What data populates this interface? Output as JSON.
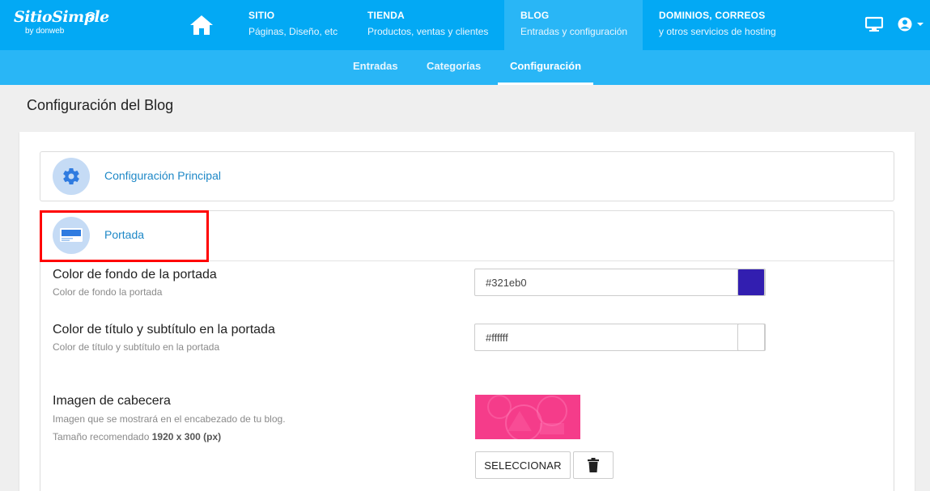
{
  "logo": {
    "brand": "SitioSimple",
    "sub": "by donweb"
  },
  "nav": [
    {
      "title": "SITIO",
      "subtitle": "Páginas, Diseño, etc"
    },
    {
      "title": "TIENDA",
      "subtitle": "Productos, ventas y clientes"
    },
    {
      "title": "BLOG",
      "subtitle": "Entradas y configuración"
    },
    {
      "title": "DOMINIOS, CORREOS",
      "subtitle": "y otros servicios de hosting"
    }
  ],
  "subnav": [
    "Entradas",
    "Categorías",
    "Configuración"
  ],
  "page_title": "Configuración del Blog",
  "panels": [
    {
      "label": "Configuración Principal",
      "icon": "gear-icon"
    },
    {
      "label": "Portada",
      "icon": "screen-icon"
    }
  ],
  "fields": {
    "bg_color": {
      "label": "Color de fondo de la portada",
      "help": "Color de fondo la portada",
      "value": "#321eb0",
      "swatch": "#321eb0"
    },
    "title_color": {
      "label": "Color de título y subtítulo en la portada",
      "help": "Color de título y subtítulo en la portada",
      "value": "#ffffff",
      "swatch": "#ffffff"
    },
    "header_image": {
      "label": "Imagen de cabecera",
      "help": "Imagen que se mostrará en el encabezado de tu blog.",
      "size_prefix": "Tamaño recomendado ",
      "size_value": "1920 x 300 (px)",
      "select_label": "SELECCIONAR"
    }
  },
  "colors": {
    "accent": "#03a9f4",
    "subnav": "#29b6f6",
    "link": "#1e88c7",
    "image": "#f53c8a"
  }
}
